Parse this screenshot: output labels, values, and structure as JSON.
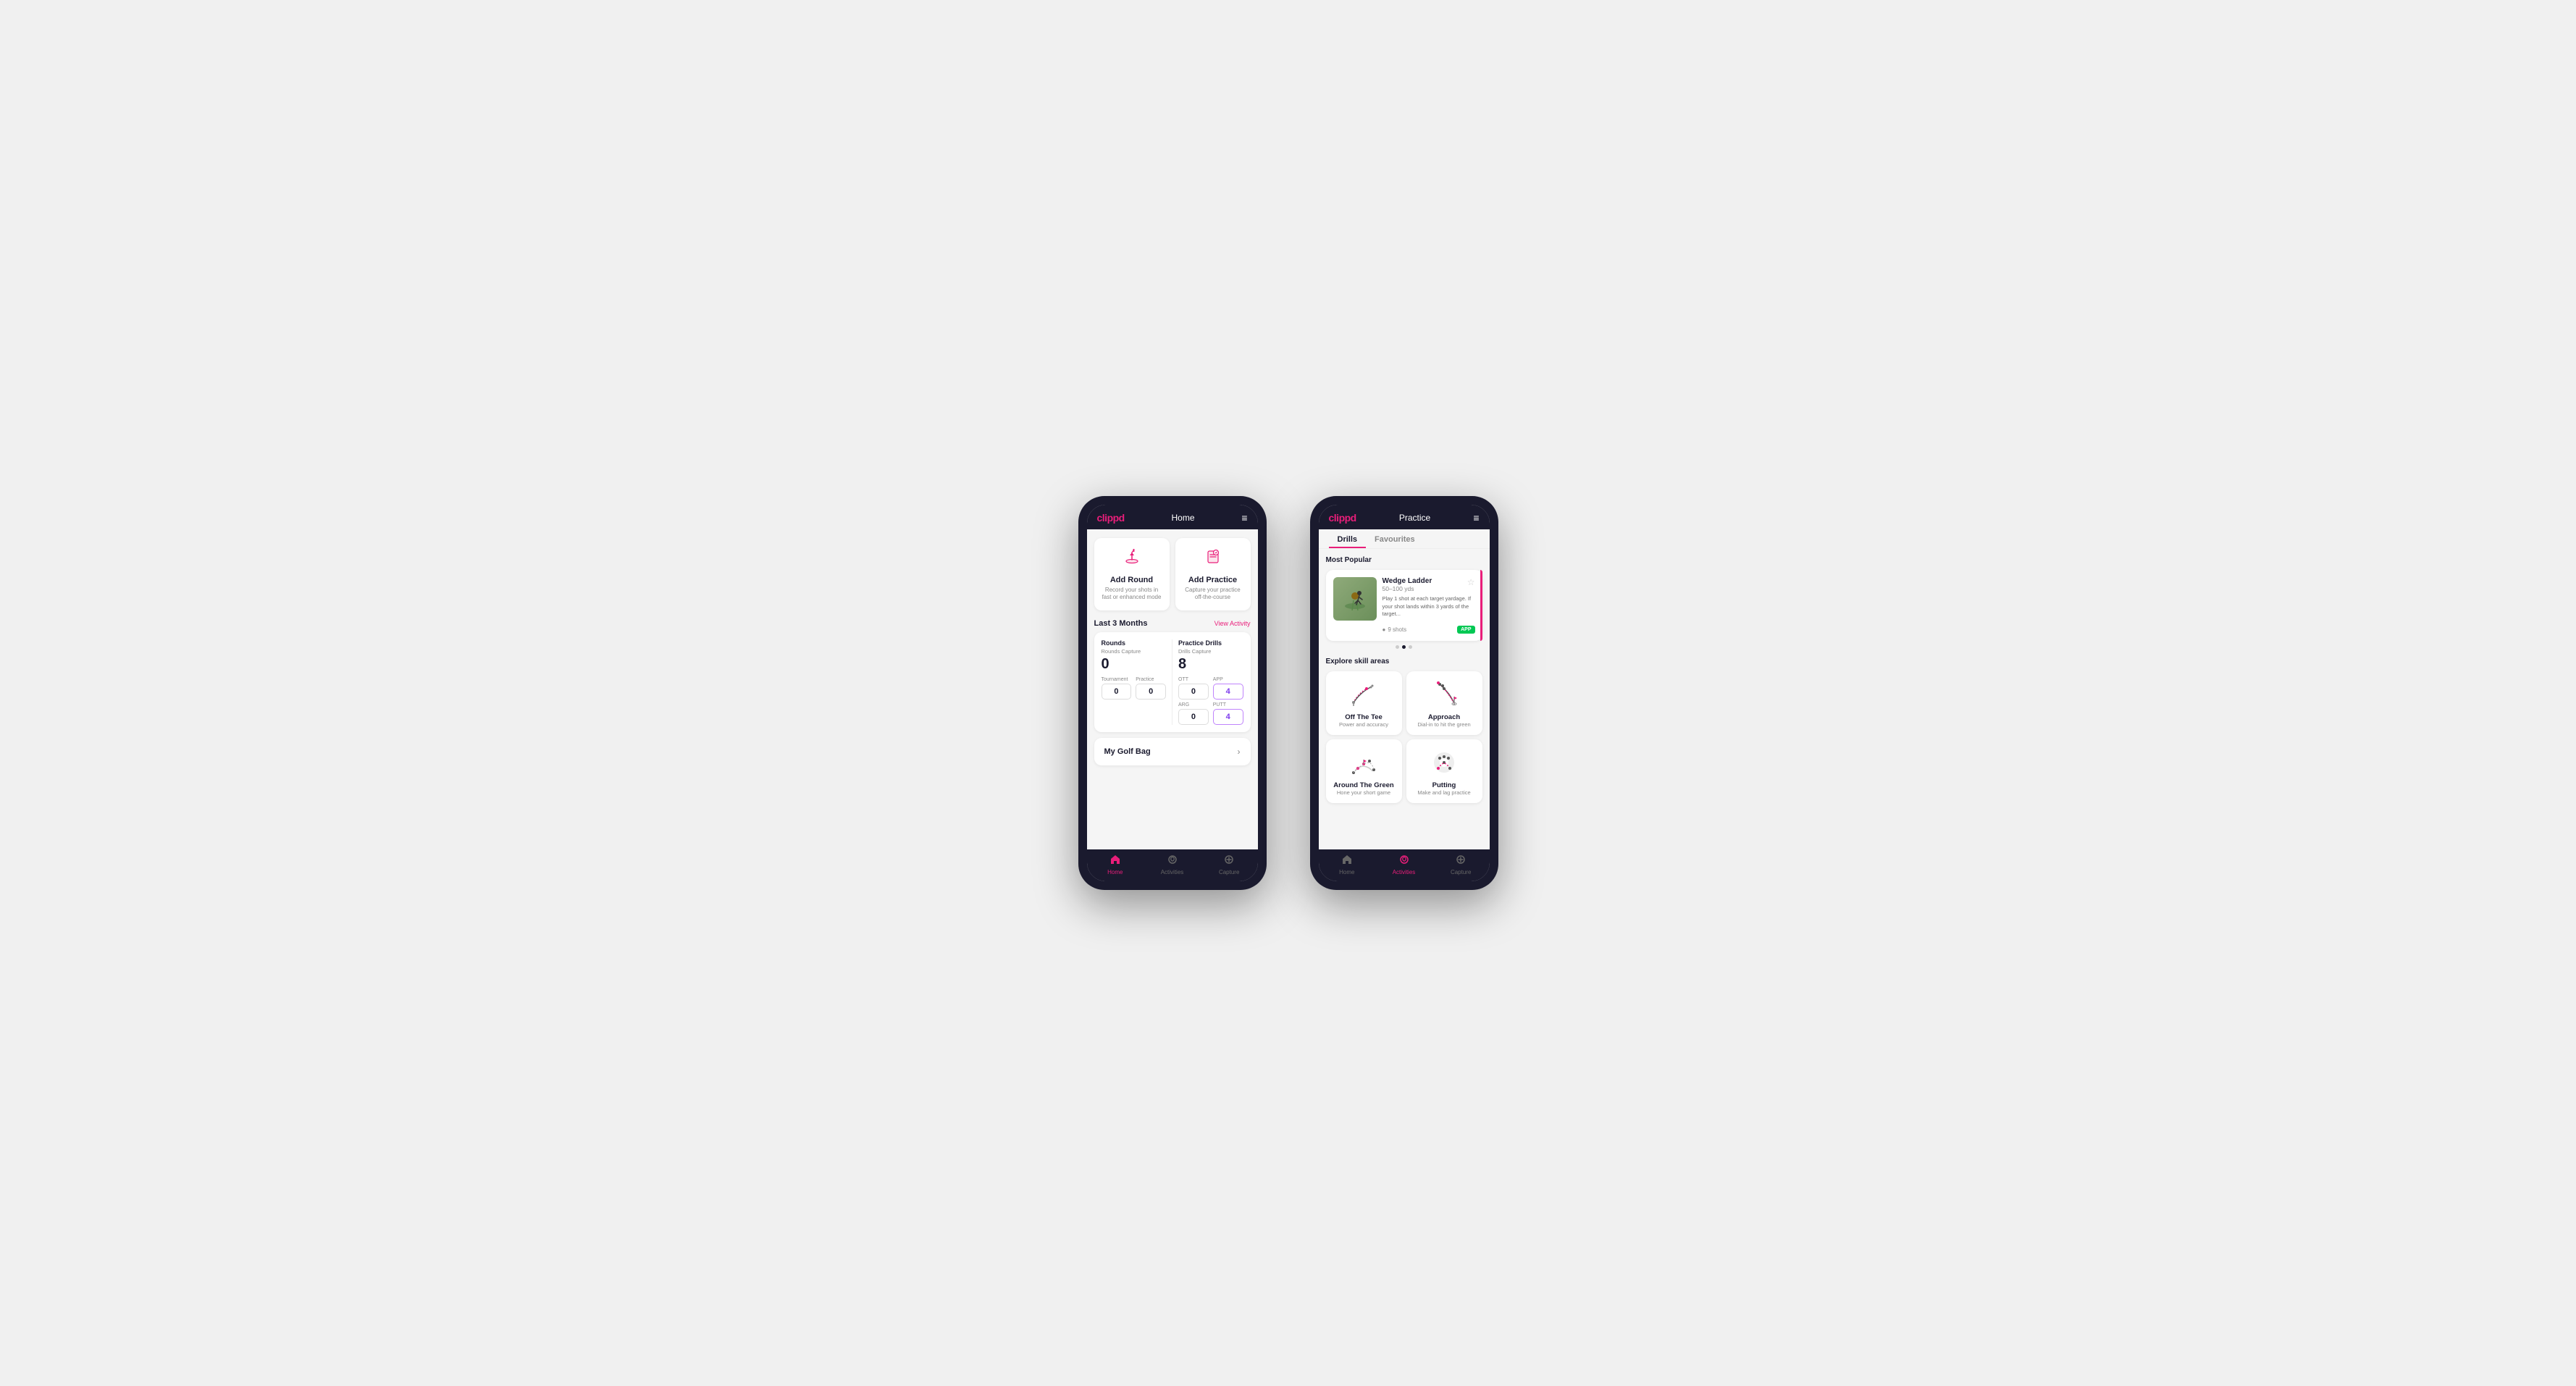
{
  "phone1": {
    "header": {
      "logo": "clippd",
      "title": "Home",
      "menu_icon": "≡"
    },
    "actions": [
      {
        "id": "add-round",
        "icon": "⛳",
        "title": "Add Round",
        "desc": "Record your shots in fast or enhanced mode"
      },
      {
        "id": "add-practice",
        "icon": "🎯",
        "title": "Add Practice",
        "desc": "Capture your practice off-the-course"
      }
    ],
    "last3months": {
      "label": "Last 3 Months",
      "link": "View Activity"
    },
    "stats": {
      "rounds": {
        "title": "Rounds",
        "capture_label": "Rounds Capture",
        "total": "0",
        "sub": [
          {
            "label": "Tournament",
            "value": "0"
          },
          {
            "label": "Practice",
            "value": "0"
          }
        ]
      },
      "drills": {
        "title": "Practice Drills",
        "capture_label": "Drills Capture",
        "total": "8",
        "sub": [
          {
            "label": "OTT",
            "value": "0"
          },
          {
            "label": "APP",
            "value": "4",
            "highlight": true
          },
          {
            "label": "ARG",
            "value": "0"
          },
          {
            "label": "PUTT",
            "value": "4",
            "highlight": true
          }
        ]
      }
    },
    "golf_bag": {
      "label": "My Golf Bag",
      "chevron": "›"
    },
    "nav": [
      {
        "icon": "🏠",
        "label": "Home",
        "active": true
      },
      {
        "icon": "⚡",
        "label": "Activities",
        "active": false
      },
      {
        "icon": "➕",
        "label": "Capture",
        "active": false
      }
    ]
  },
  "phone2": {
    "header": {
      "logo": "clippd",
      "title": "Practice",
      "menu_icon": "≡"
    },
    "tabs": [
      {
        "label": "Drills",
        "active": true
      },
      {
        "label": "Favourites",
        "active": false
      }
    ],
    "most_popular": {
      "title": "Most Popular",
      "drill": {
        "name": "Wedge Ladder",
        "range": "50–100 yds",
        "desc": "Play 1 shot at each target yardage. If your shot lands within 3 yards of the target...",
        "shots": "9 shots",
        "badge": "APP",
        "star": "☆"
      },
      "dots": [
        {
          "active": false
        },
        {
          "active": true
        },
        {
          "active": false
        }
      ]
    },
    "explore": {
      "title": "Explore skill areas",
      "skills": [
        {
          "id": "off-the-tee",
          "name": "Off The Tee",
          "desc": "Power and accuracy"
        },
        {
          "id": "approach",
          "name": "Approach",
          "desc": "Dial-in to hit the green"
        },
        {
          "id": "around-the-green",
          "name": "Around The Green",
          "desc": "Hone your short game"
        },
        {
          "id": "putting",
          "name": "Putting",
          "desc": "Make and lag practice"
        }
      ]
    },
    "nav": [
      {
        "icon": "🏠",
        "label": "Home",
        "active": false
      },
      {
        "icon": "⚡",
        "label": "Activities",
        "active": true
      },
      {
        "icon": "➕",
        "label": "Capture",
        "active": false
      }
    ]
  }
}
